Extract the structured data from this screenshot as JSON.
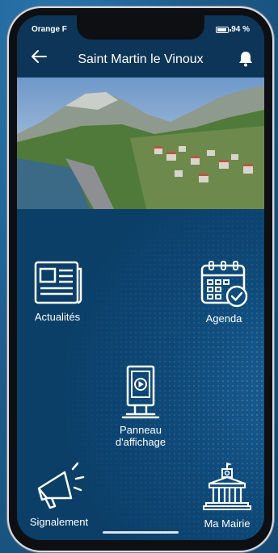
{
  "status": {
    "carrier": "Orange F",
    "battery": "94 %",
    "battery_level": 0.94
  },
  "header": {
    "title": "Saint Martin le Vinoux"
  },
  "tiles": {
    "news": "Actualités",
    "agenda": "Agenda",
    "board_line1": "Panneau",
    "board_line2": "d'affichage",
    "report": "Signalement",
    "townhall": "Ma Mairie"
  },
  "colors": {
    "header": "#0d3557",
    "background": "#0b3f68",
    "outer": "#1d5c8c"
  }
}
